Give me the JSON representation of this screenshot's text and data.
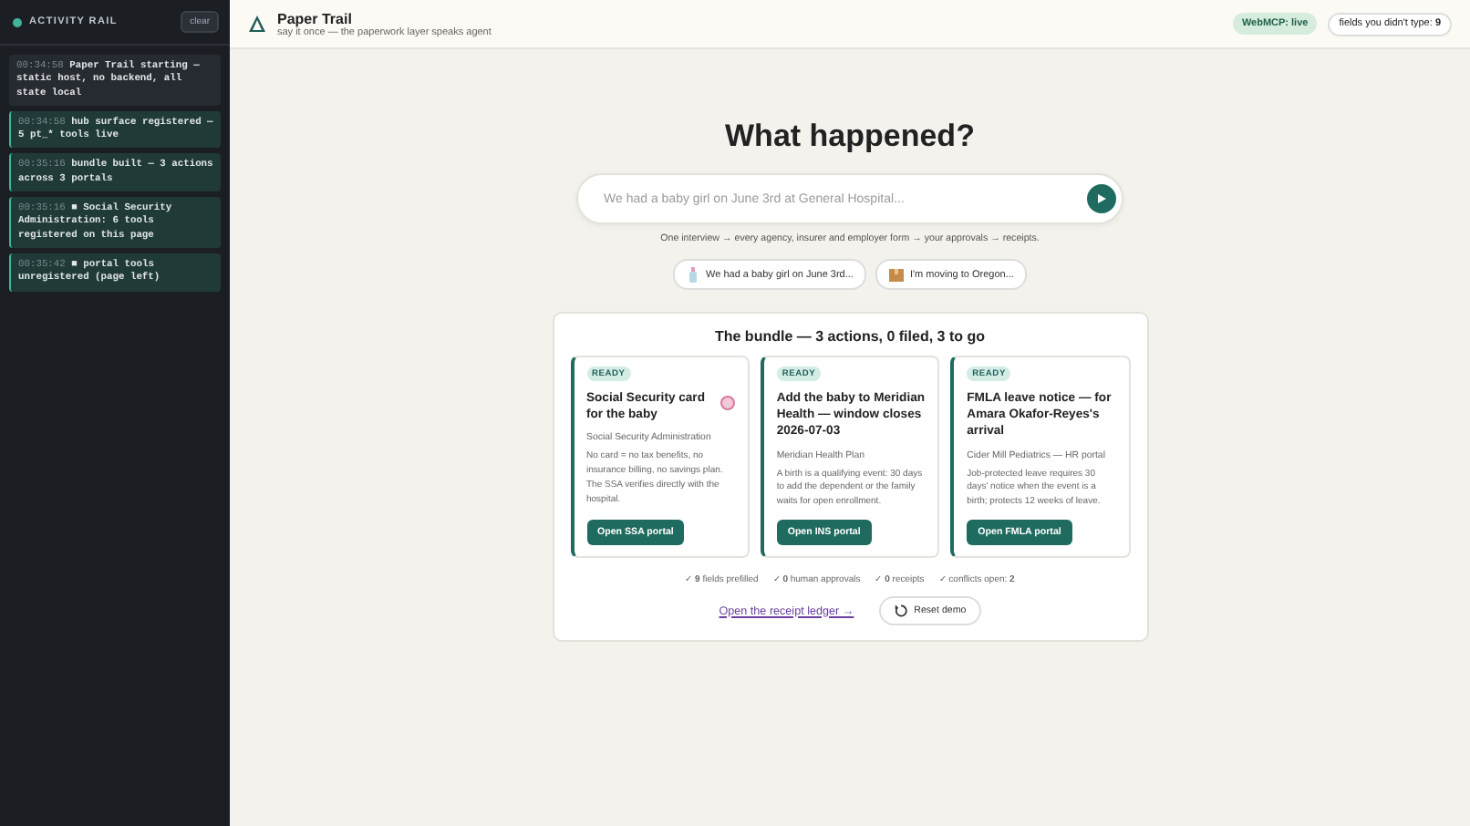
{
  "sidebar": {
    "title": "ACTIVITY RAIL",
    "clear_button": "clear",
    "entries": [
      {
        "kind": "plain",
        "time": "00:34:58",
        "text": "Paper Trail starting — static host, no backend, all state local"
      },
      {
        "kind": "event",
        "time": "00:34:58",
        "text": "hub surface registered — 5 pt_* tools live"
      },
      {
        "kind": "event",
        "time": "00:35:16",
        "text": "bundle built — 3 actions across 3 portals"
      },
      {
        "kind": "event",
        "time": "00:35:16",
        "text": "■ Social Security Administration: 6 tools registered on this page"
      },
      {
        "kind": "event",
        "time": "00:35:42",
        "text": "■ portal tools unregistered (page left)"
      }
    ]
  },
  "header": {
    "app_name": "Paper Trail",
    "tagline": "say it once — the paperwork layer speaks agent",
    "status_badge": "WebMCP: live",
    "counter_label": "fields you didn't type:",
    "counter_value": "9"
  },
  "hero": {
    "title": "What happened?",
    "search": {
      "placeholder": "We had a baby girl on June 3rd at General Hospital..."
    },
    "subtitle": "One interview → every agency, insurer and employer form → your approvals → receipts.",
    "examples": [
      {
        "kind": "bottle",
        "label": "We had a baby girl on June 3rd..."
      },
      {
        "kind": "box",
        "label": "I'm moving to Oregon..."
      }
    ]
  },
  "bundle": {
    "title": "The bundle — 3 actions, 0 filed, 3 to go",
    "cards": [
      {
        "status": "READY",
        "title": "Social Security card for the baby",
        "marker": true,
        "agency": "Social Security Administration",
        "description": "No card = no tax benefits, no insurance billing, no savings plan. The SSA verifies directly with the hospital.",
        "button": "Open SSA portal"
      },
      {
        "status": "READY",
        "title": "Add the baby to Meridian Health — window closes 2026-07-03",
        "marker": false,
        "agency": "Meridian Health Plan",
        "description": "A birth is a qualifying event: 30 days to add the dependent or the family waits for open enrollment.",
        "button": "Open INS portal"
      },
      {
        "status": "READY",
        "title": "FMLA leave notice — for Amara Okafor-Reyes's arrival",
        "marker": false,
        "agency": "Cider Mill Pediatrics — HR portal",
        "description": "Job-protected leave requires 30 days' notice when the event is a birth; protects 12 weeks of leave.",
        "button": "Open FMLA portal"
      }
    ],
    "stats": [
      "✓ **9** fields prefilled",
      "✓ **0** human approvals",
      "✓ **0** receipts",
      "✓ conflicts open: **2**"
    ],
    "ledger_link": "Open the receipt ledger →",
    "reset_button": "Reset demo"
  }
}
